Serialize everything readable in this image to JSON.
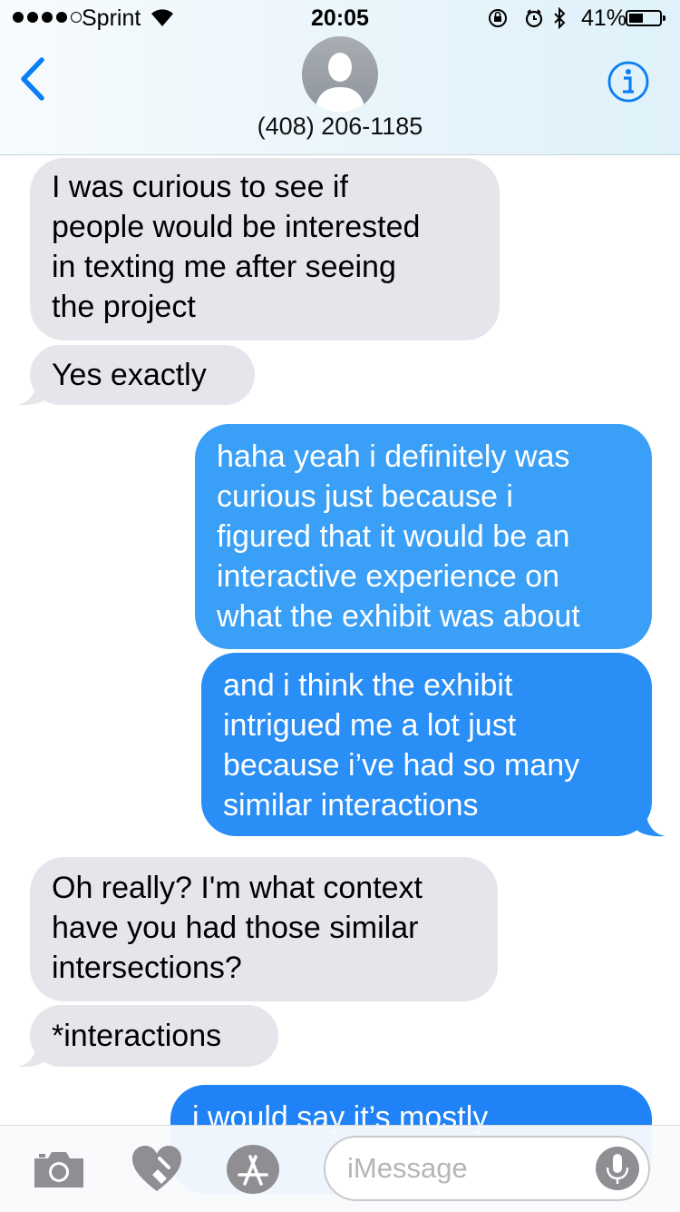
{
  "status_bar": {
    "carrier": "Sprint",
    "time": "20:05",
    "battery_percent": "41%",
    "battery_level": 0.41,
    "signal_bars_filled": 4,
    "signal_bars_total": 5,
    "icons": [
      "wifi-icon",
      "orientation-lock-icon",
      "alarm-icon",
      "bluetooth-icon",
      "battery-icon"
    ]
  },
  "header": {
    "contact": "(408) 206-1185",
    "icons": [
      "chevron-left-icon",
      "avatar-icon",
      "info-icon"
    ]
  },
  "messages": [
    {
      "direction": "incoming",
      "lines": [
        "I was curious to see if",
        "people would be interested",
        "in texting me after seeing",
        "the project"
      ]
    },
    {
      "direction": "incoming",
      "lines": [
        "Yes exactly"
      ]
    },
    {
      "direction": "outgoing",
      "lines": [
        "haha yeah i definitely was",
        "curious just because i",
        "figured that it would be an",
        "interactive experience on",
        "what the exhibit was about"
      ]
    },
    {
      "direction": "outgoing",
      "lines": [
        "and i think the exhibit",
        "intrigued me a lot just",
        "because i’ve had so many",
        "similar interactions"
      ]
    },
    {
      "direction": "incoming",
      "lines": [
        "Oh really? I'm what context",
        "have you had those similar",
        "intersections?"
      ]
    },
    {
      "direction": "incoming",
      "lines": [
        "*interactions"
      ]
    },
    {
      "direction": "outgoing",
      "lines": [
        "i would say it’s mostly"
      ]
    }
  ],
  "colors": {
    "incoming_bubble": "#e6e5eb",
    "outgoing_bubble": "#3a9ff6",
    "accent": "#007aff"
  },
  "input_bar": {
    "placeholder": "iMessage",
    "icons": [
      "camera-icon",
      "digital-touch-heart-icon",
      "app-store-icon",
      "microphone-icon"
    ]
  }
}
